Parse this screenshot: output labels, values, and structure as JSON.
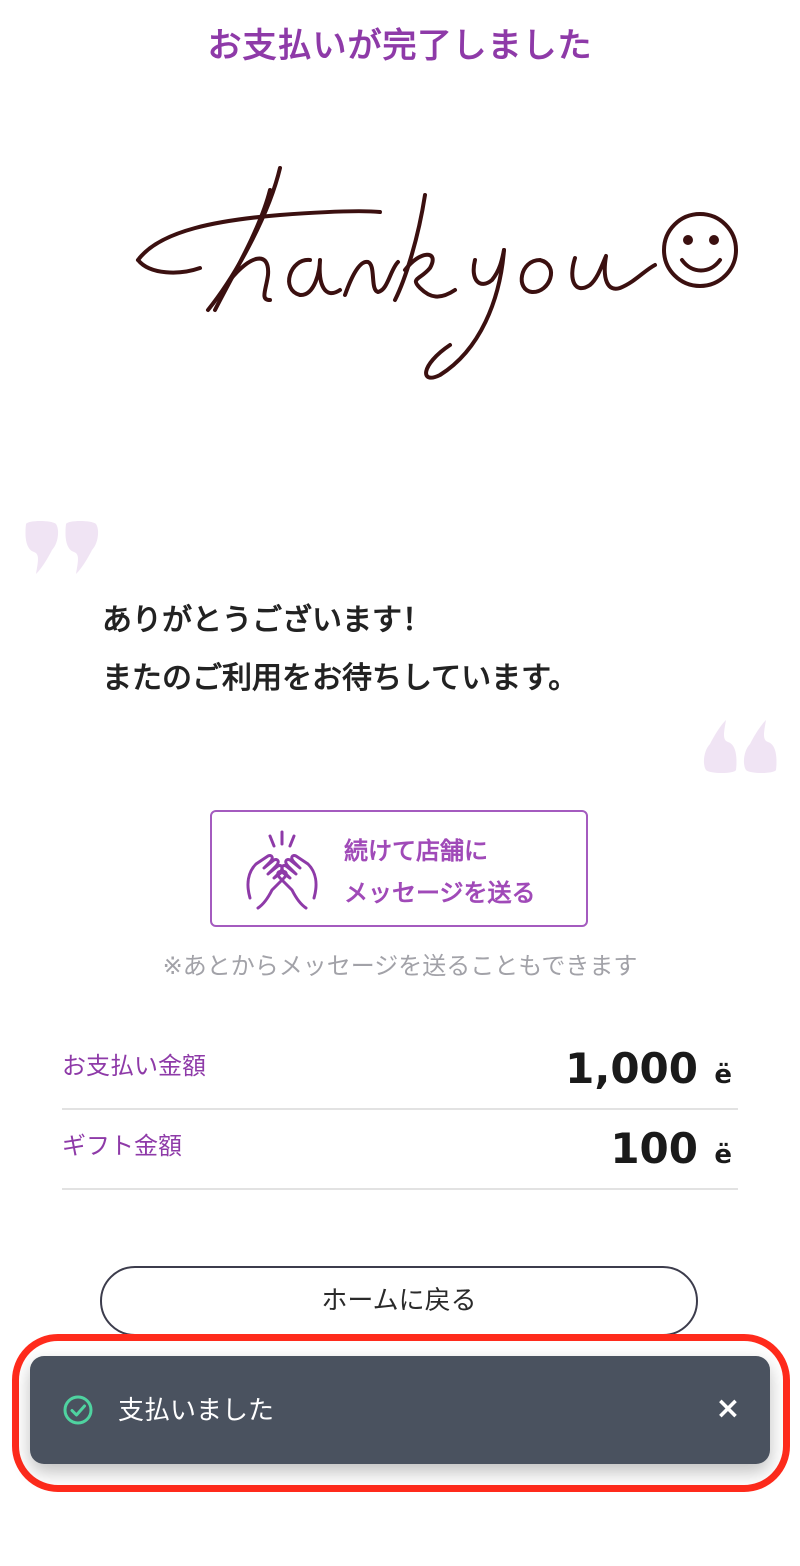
{
  "page": {
    "title": "お支払いが完了しました"
  },
  "thank_you_image": {
    "text": "Thank you",
    "icon": "smiley-icon"
  },
  "message": {
    "line1": "ありがとうございます！",
    "line2": "またのご利用をお待ちしています。"
  },
  "send_message_button": {
    "line1": "続けて店舗に",
    "line2": "メッセージを送る",
    "icon": "clapping-hands-icon"
  },
  "note": "※あとからメッセージを送ることもできます",
  "amounts": [
    {
      "label": "お支払い金額",
      "value": "1,000",
      "unit": "ë"
    },
    {
      "label": "ギフト金額",
      "value": "100",
      "unit": "ë"
    }
  ],
  "home_button": {
    "label": "ホームに戻る"
  },
  "toast": {
    "message": "支払いました",
    "icon": "check-circle-icon",
    "close": "×"
  },
  "colors": {
    "accent": "#8e3aa8",
    "toast_bg": "#4a525f",
    "highlight": "#ff2b1c",
    "success": "#4fd3a0"
  }
}
